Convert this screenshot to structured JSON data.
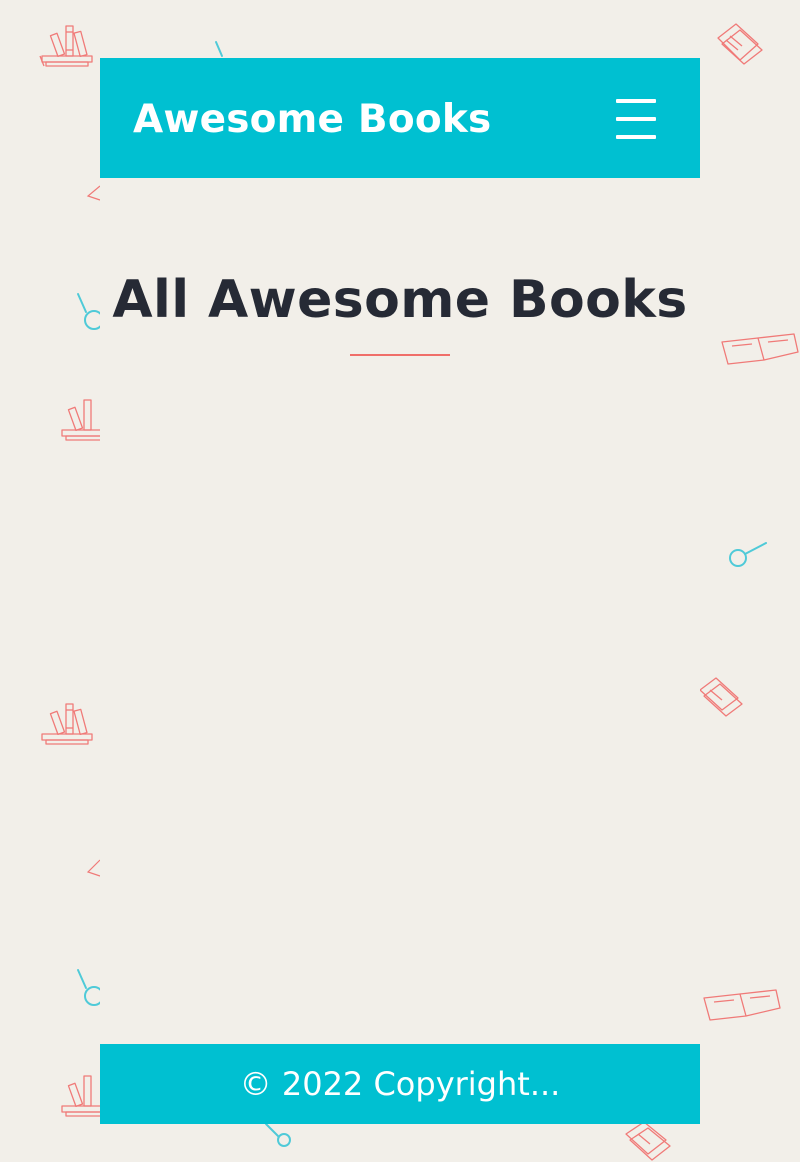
{
  "header": {
    "brand_title": "Awesome Books",
    "menu_icon": "hamburger-menu-icon"
  },
  "main": {
    "heading": "All Awesome Books",
    "books": []
  },
  "footer": {
    "copyright": "© 2022 Copyright..."
  },
  "background": {
    "doodle_icons": [
      "book-stack-icon",
      "open-book-icon",
      "closed-books-icon",
      "magnifier-icon"
    ]
  },
  "colors": {
    "accent": "#00c0d1",
    "page_background": "#f2efe9",
    "heading_text": "#262a35",
    "underline": "#f06e69",
    "doodle_red": "#f07a78",
    "doodle_cyan": "#4fcad8"
  }
}
